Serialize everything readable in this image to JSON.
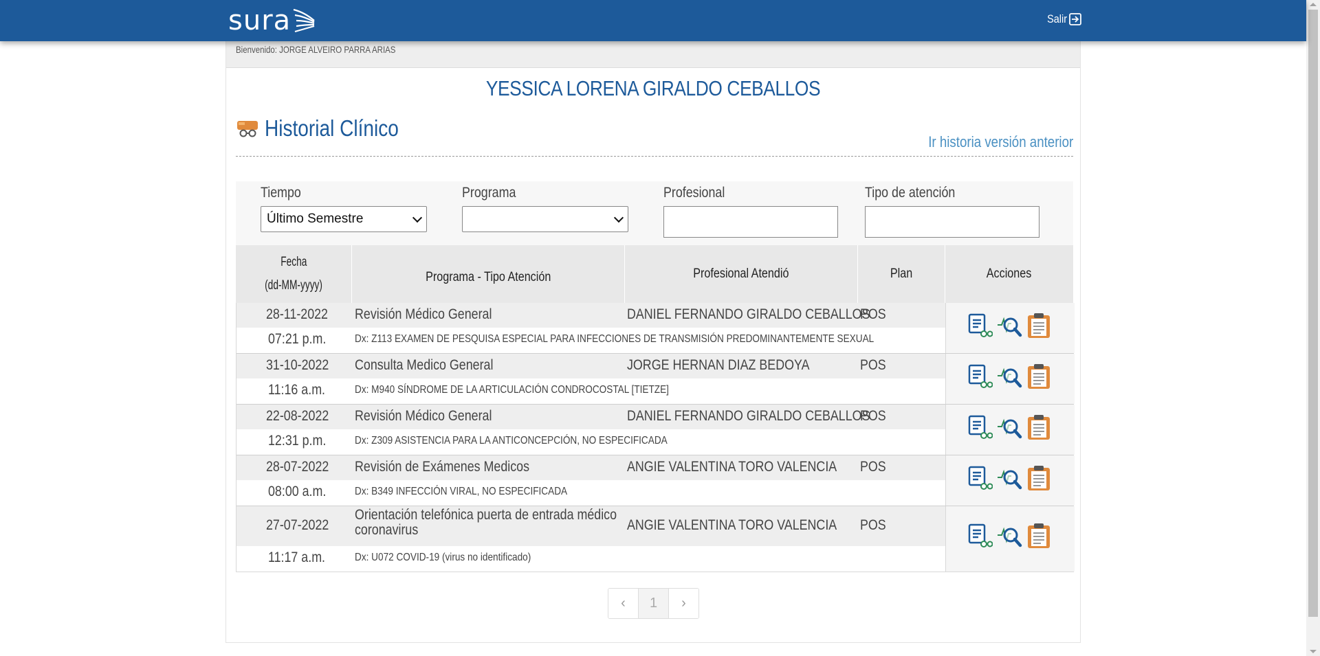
{
  "header": {
    "logo_text": "sura",
    "logout_label": "Salir"
  },
  "welcome": "Bienvenido: JORGE ALVEIRO PARRA ARIAS",
  "patient_name": "YESSICA LORENA GIRALDO CEBALLOS",
  "section_title": "Historial Clínico",
  "previous_link": "Ir historia versión anterior",
  "filters": {
    "tiempo_label": "Tiempo",
    "tiempo_value": "Último Semestre",
    "programa_label": "Programa",
    "programa_value": "",
    "profesional_label": "Profesional",
    "profesional_value": "",
    "tipo_label": "Tipo de atención",
    "tipo_value": ""
  },
  "table": {
    "headers": {
      "fecha_line1": "Fecha",
      "fecha_line2": "(dd-MM-yyyy)",
      "programa": "Programa - Tipo Atención",
      "profesional": "Profesional Atendió",
      "plan": "Plan",
      "acciones": "Acciones"
    },
    "rows": [
      {
        "date": "28-11-2022",
        "time": "07:21 p.m.",
        "program": "Revisión Médico General",
        "professional": "DANIEL FERNANDO GIRALDO CEBALLOS",
        "plan": "POS",
        "dx": "Dx: Z113 EXAMEN DE PESQUISA ESPECIAL PARA INFECCIONES DE TRANSMISIÓN PREDOMINANTEMENTE SEXUAL"
      },
      {
        "date": "31-10-2022",
        "time": "11:16 a.m.",
        "program": "Consulta Medico General",
        "professional": "JORGE HERNAN DIAZ BEDOYA",
        "plan": "POS",
        "dx": "Dx: M940 SÍNDROME DE LA ARTICULACIÓN CONDROCOSTAL [TIETZE]"
      },
      {
        "date": "22-08-2022",
        "time": "12:31 p.m.",
        "program": "Revisión Médico General",
        "professional": "DANIEL FERNANDO GIRALDO CEBALLOS",
        "plan": "POS",
        "dx": "Dx: Z309 ASISTENCIA PARA LA ANTICONCEPCIÓN, NO ESPECIFICADA"
      },
      {
        "date": "28-07-2022",
        "time": "08:00 a.m.",
        "program": "Revisión de Exámenes Medicos",
        "professional": "ANGIE VALENTINA TORO VALENCIA",
        "plan": "POS",
        "dx": "Dx: B349 INFECCIÓN VIRAL, NO ESPECIFICADA"
      },
      {
        "date": "27-07-2022",
        "time": "11:17 a.m.",
        "program_line1": "Orientación telefónica puerta de entrada médico",
        "program_line2": "coronavirus",
        "professional": "ANGIE VALENTINA TORO VALENCIA",
        "plan": "POS",
        "dx": "Dx: U072 COVID-19 (virus no identificado)"
      }
    ]
  },
  "pagination": {
    "prev": "‹",
    "current": "1",
    "next": "›"
  },
  "colors": {
    "brand_blue": "#1d5a9a",
    "link_blue": "#4a90c2",
    "icon_orange": "#e08a3c"
  },
  "icons": [
    "logo-wings-icon",
    "logout-icon",
    "clinical-history-icon",
    "view-record-icon",
    "analysis-search-icon",
    "clipboard-icon",
    "chevron-down-icon"
  ]
}
